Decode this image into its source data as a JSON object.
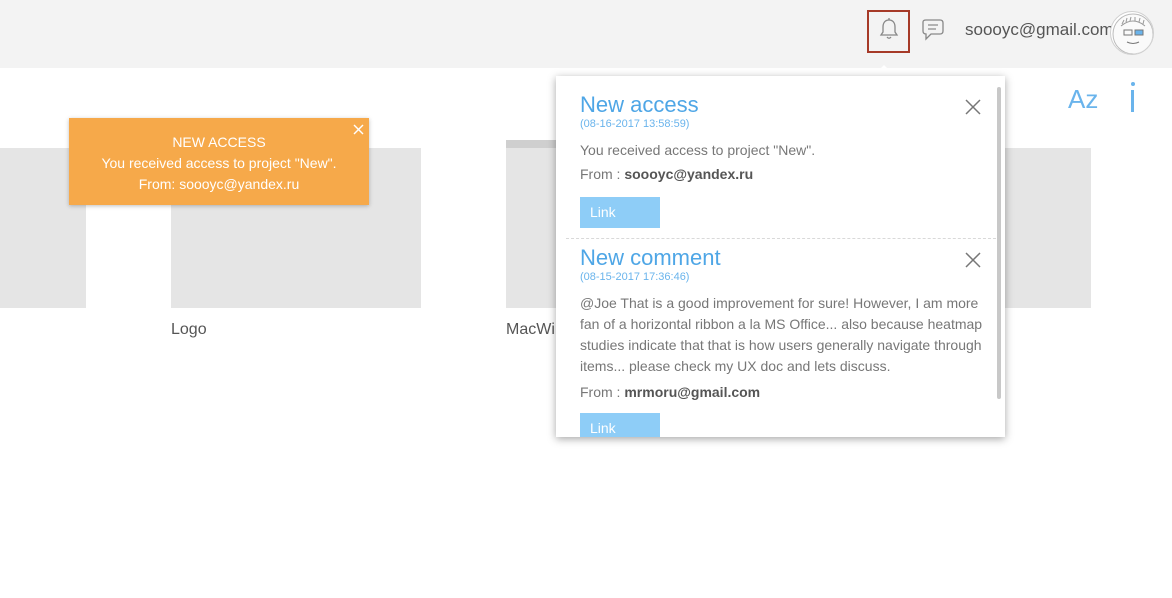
{
  "header": {
    "user_email": "soooyc@gmail.com",
    "bell_icon": "bell-icon",
    "chat_icon": "chat-bubble-icon",
    "highlight_color": "#a63a28"
  },
  "tools": {
    "sort_label": "Az",
    "accent_color": "#6ab4ec"
  },
  "projects": [
    {
      "label": ""
    },
    {
      "label": "Logo"
    },
    {
      "label": "MacWi"
    },
    {
      "label": ""
    }
  ],
  "toast": {
    "title": "NEW ACCESS",
    "message": "You received access to project \"New\".",
    "from": "From: soooyc@yandex.ru",
    "color": "#f6a94a"
  },
  "notifications": [
    {
      "title": "New access",
      "date": "(08-16-2017 13:58:59)",
      "body": "You received access to project \"New\".",
      "from_label": "From :",
      "from_value": "soooyc@yandex.ru",
      "link_label": "Link"
    },
    {
      "title": "New comment",
      "date": "(08-15-2017 17:36:46)",
      "body": "@Joe That is a good improvement for sure! However, I am more fan of a horizontal ribbon a la MS Office... also because heatmap studies indicate that that is how users generally navigate through items... please check my UX doc and lets discuss.",
      "from_label": "From :",
      "from_value": "mrmoru@gmail.com",
      "link_label": "Link"
    }
  ]
}
